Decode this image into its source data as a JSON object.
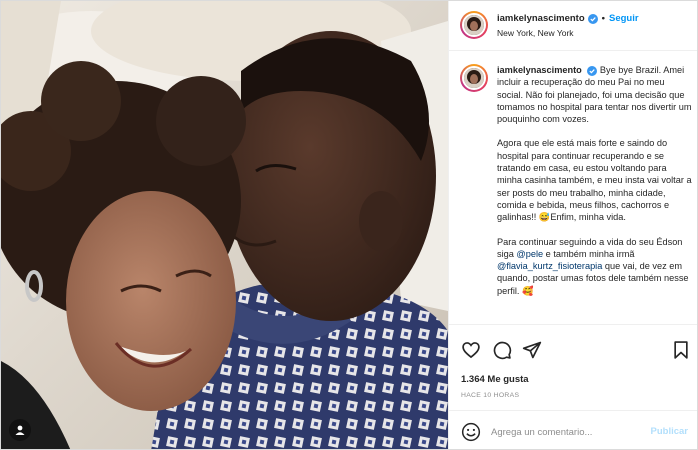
{
  "post": {
    "username": "iamkelynascimento",
    "follow_label": "Seguir",
    "location": "New York, New York",
    "caption_paragraphs": [
      "Bye bye Brazil. Amei incluir a recuperação do meu Pai no meu social. Não foi planejado, foi uma decisão que tomamos no hospital para tentar nos divertir um pouquinho com vozes.",
      "Agora que ele está mais forte e saindo do hospital para continuar recuperando e se tratando em casa, eu estou voltando para minha casinha também, e meu insta vai voltar a ser posts do meu trabalho, minha cidade, comida e bebida, meus filhos, cachorros e galinhas!! 😅Enfim, minha vida.",
      "Para continuar seguindo a vida do seu Édson siga @pele e também minha irmã @flavia_kurtz_fisioterapia que vai, de vez em quando, postar umas fotos dele também nesse perfil. 🥰"
    ],
    "likes": "1.364 Me gusta",
    "timestamp": "HACE 10 HORAS",
    "comment_placeholder": "Agrega un comentario...",
    "publish_label": "Publicar"
  },
  "icons": {
    "heart": "heart-icon",
    "comment": "comment-icon",
    "share": "share-icon",
    "save": "bookmark-icon",
    "emoji": "emoji-icon",
    "verified": "verified-badge-icon",
    "tag": "user-tag-icon"
  },
  "colors": {
    "accent": "#0095f6",
    "verified": "#3897f0",
    "publish_disabled": "#b2dffc",
    "muted": "#8e8e8e"
  }
}
